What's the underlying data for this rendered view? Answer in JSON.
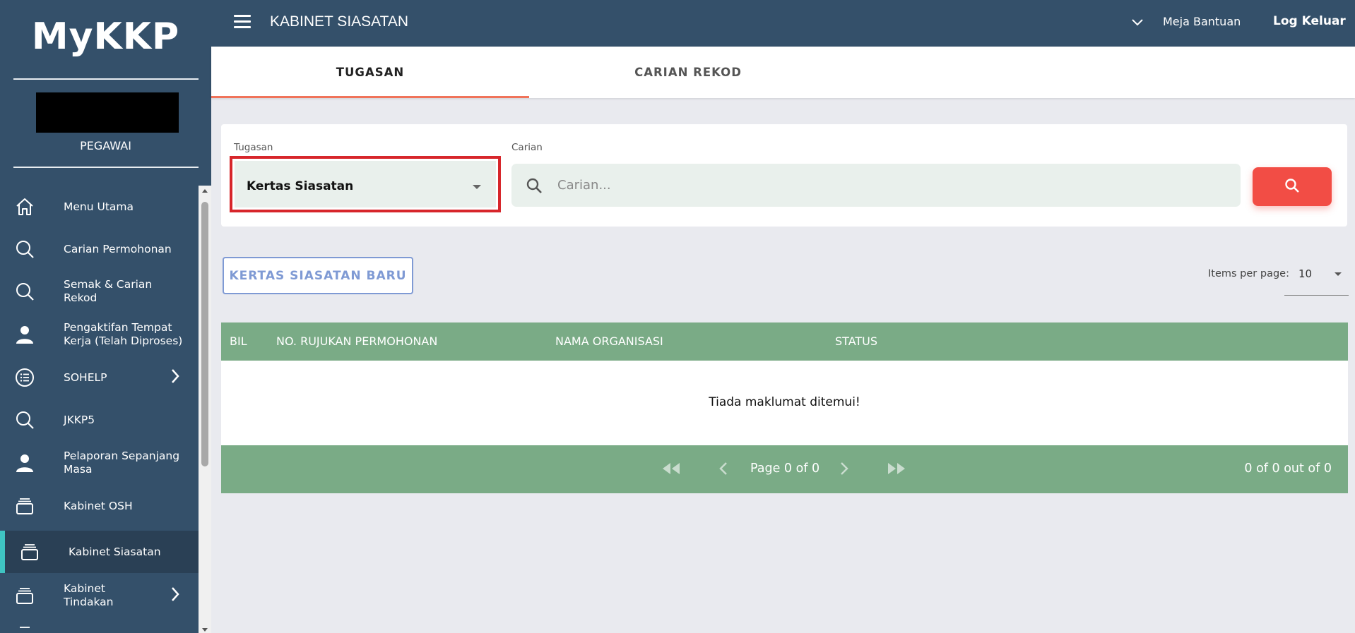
{
  "app": {
    "brand": "MyKKP",
    "role": "PEGAWAI"
  },
  "sidebar": {
    "items": [
      {
        "label": "Menu Utama",
        "icon": "home-icon"
      },
      {
        "label": "Carian Permohonan",
        "icon": "search-icon"
      },
      {
        "label": "Semak & Carian Rekod",
        "icon": "search-icon"
      },
      {
        "label": "Pengaktifan Tempat Kerja (Telah Diproses)",
        "icon": "user-icon"
      },
      {
        "label": "SOHELP",
        "icon": "list-icon",
        "has_submenu": true
      },
      {
        "label": "JKKP5",
        "icon": "search-icon"
      },
      {
        "label": "Pelaporan Sepanjang Masa",
        "icon": "user-icon"
      },
      {
        "label": "Kabinet OSH",
        "icon": "cabinet-icon"
      },
      {
        "label": "Kabinet Siasatan",
        "icon": "cabinet-icon",
        "active": true
      },
      {
        "label": "Kabinet Tindakan",
        "icon": "cabinet-icon",
        "has_submenu": true
      }
    ]
  },
  "header": {
    "title": "KABINET SIASATAN",
    "help": "Meja Bantuan",
    "logout": "Log Keluar"
  },
  "tabs": [
    {
      "label": "TUGASAN",
      "active": true
    },
    {
      "label": "CARIAN REKOD",
      "active": false
    }
  ],
  "filter": {
    "task_label": "Tugasan",
    "task_value": "Kertas Siasatan",
    "search_label": "Carian",
    "search_placeholder": "Carian..."
  },
  "actions": {
    "new_button": "KERTAS SIASATAN BARU"
  },
  "pagination_size": {
    "label": "Items per page:",
    "value": "10"
  },
  "table": {
    "columns": [
      "BIL",
      "NO. RUJUKAN PERMOHONAN",
      "NAMA ORGANISASI",
      "STATUS"
    ],
    "empty_message": "Tiada maklumat ditemui!",
    "page_text": "Page 0 of 0",
    "count_text": "0 of 0 out of 0"
  },
  "colors": {
    "sidebar": "#34506a",
    "accent": "#3fc4c2",
    "table_header": "#7aab86",
    "search_button": "#f24d45",
    "tab_ink": "#f0735a",
    "highlight": "#d7262b"
  }
}
